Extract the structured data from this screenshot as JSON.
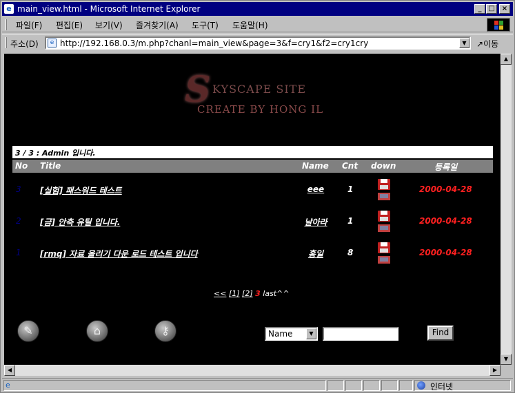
{
  "window": {
    "title": "main_view.html - Microsoft Internet Explorer"
  },
  "menu": [
    "파일(F)",
    "편집(E)",
    "보기(V)",
    "즐겨찾기(A)",
    "도구(T)",
    "도움말(H)"
  ],
  "address": {
    "label": "주소(D)",
    "url": "http://192.168.0.3/m.php?chanl=main_view&page=3&f=cry1&f2=cry1cry",
    "go": "이동"
  },
  "logo": {
    "line1": "KYSCAPE SITE",
    "line2": "CREATE BY HONG IL",
    "initial": "S"
  },
  "board": {
    "info": "3 / 3 : Admin 입니다.",
    "columns": {
      "no": "No",
      "title": "Title",
      "name": "Name",
      "cnt": "Cnt",
      "down": "down",
      "date": "등록일"
    },
    "rows": [
      {
        "no": "3",
        "title": "[실험] 패스워드 테스트",
        "name": "eee",
        "cnt": "1",
        "date": "2000-04-28"
      },
      {
        "no": "2",
        "title": "[금] 안축 유틸 입니다.",
        "name": "날아라",
        "cnt": "1",
        "date": "2000-04-28"
      },
      {
        "no": "1",
        "title": "[rmq] 자료 올리기 다운 로드 테스트 입니다",
        "name": "홍일",
        "cnt": "8",
        "date": "2000-04-28"
      }
    ]
  },
  "pager": {
    "prev": "<<",
    "p1": "[1]",
    "p2": "[2]",
    "current": "3",
    "last": "last^^"
  },
  "search": {
    "field": "Name",
    "find": "Find"
  },
  "status": {
    "zone": "인터넷"
  }
}
